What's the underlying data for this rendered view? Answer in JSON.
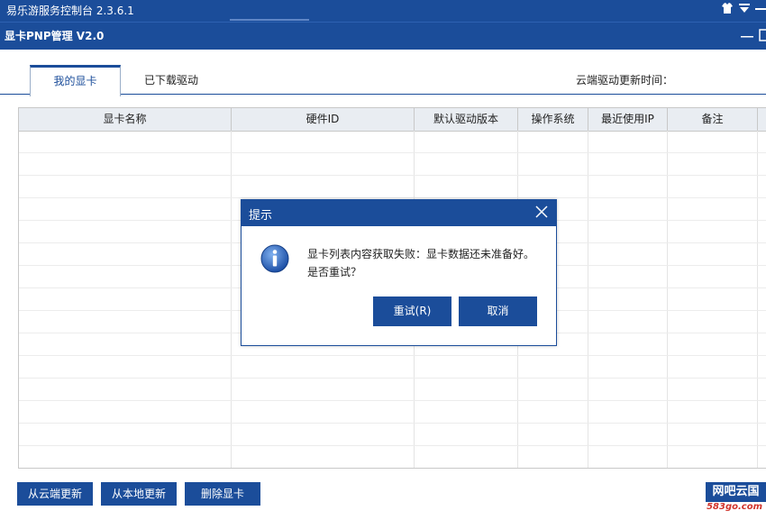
{
  "app": {
    "title": "易乐游服务控制台 2.3.6.1",
    "module_title": "显卡PNP管理 V2.0"
  },
  "tabs": [
    {
      "label": "我的显卡",
      "active": true
    },
    {
      "label": "已下载驱动",
      "active": false
    }
  ],
  "cloud_update_time_label": "云端驱动更新时间：",
  "table": {
    "columns": [
      "显卡名称",
      "硬件ID",
      "默认驱动版本",
      "操作系统",
      "最近使用IP",
      "备注"
    ],
    "rows": []
  },
  "buttons": {
    "cloud_update": "从云端更新",
    "local_update": "从本地更新",
    "delete_card": "删除显卡"
  },
  "brand": {
    "name": "网吧云国",
    "url": "583go.com"
  },
  "dialog": {
    "title": "提示",
    "message_line1": "显卡列表内容获取失败：显卡数据还未准备好。",
    "message_line2": "是否重试？",
    "retry_label": "重试(R)",
    "cancel_label": "取消"
  },
  "colors": {
    "primary": "#1b4d9a",
    "header_bg": "#e9edf2",
    "brand_url": "#d0342c"
  }
}
